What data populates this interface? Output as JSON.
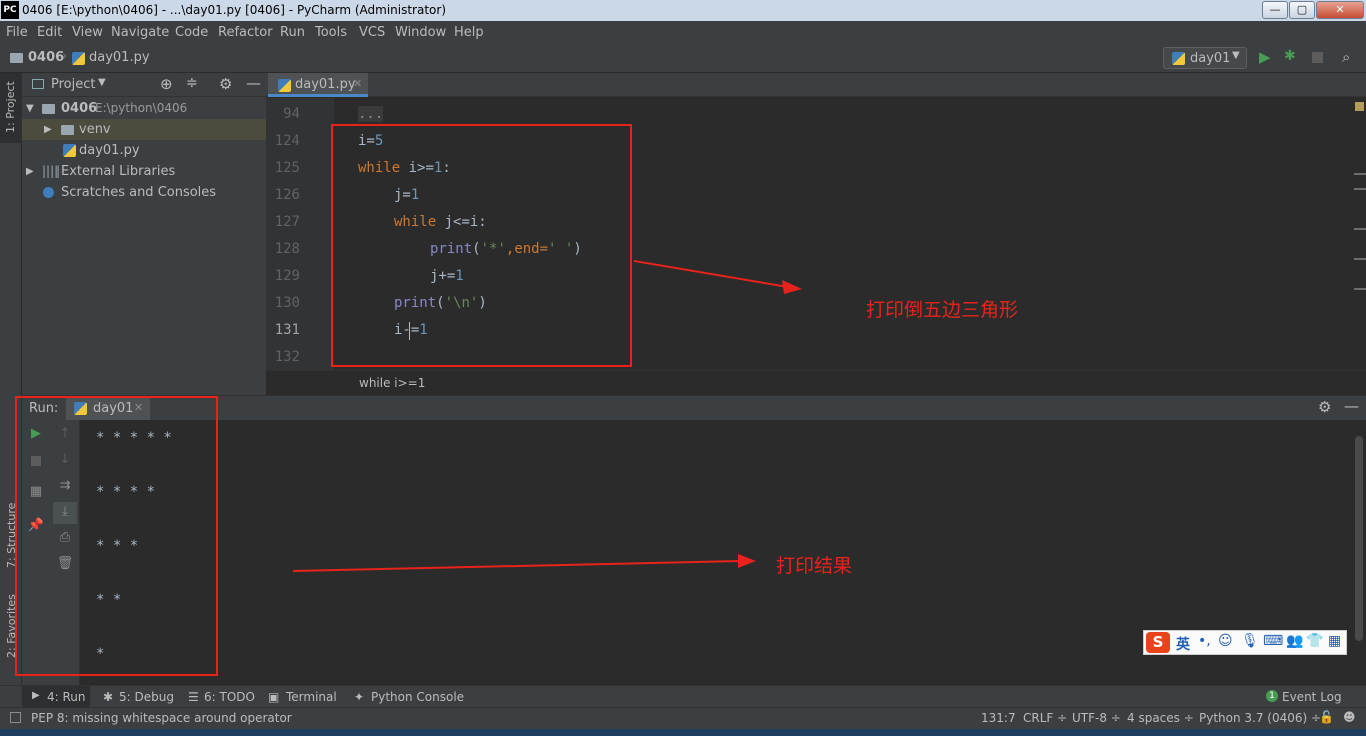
{
  "window": {
    "logo": "PC",
    "title": "0406 [E:\\python\\0406] - ...\\day01.py [0406] - PyCharm (Administrator)",
    "minimize": "—",
    "maximize": "▢",
    "close": "✕"
  },
  "menu": [
    "File",
    "Edit",
    "View",
    "Navigate",
    "Code",
    "Refactor",
    "Run",
    "Tools",
    "VCS",
    "Window",
    "Help"
  ],
  "nav": {
    "project": "0406",
    "file": "day01.py",
    "run_config": "day01"
  },
  "left_strip": {
    "project": "1: Project",
    "structure": "7: Structure",
    "favorites": "2: Favorites"
  },
  "project_panel": {
    "title": "Project",
    "tree": [
      {
        "name": "0406",
        "path": "E:\\python\\0406"
      },
      {
        "name": "venv"
      },
      {
        "name": "day01.py"
      },
      {
        "name": "External Libraries"
      },
      {
        "name": "Scratches and Consoles"
      }
    ]
  },
  "editor": {
    "tab": "day01.py",
    "line_numbers": [
      "94",
      "124",
      "125",
      "126",
      "127",
      "128",
      "129",
      "130",
      "131",
      "132"
    ],
    "folded": "...",
    "code": {
      "l124_a": "i=",
      "l124_b": "5",
      "l125_kw": "while",
      "l125_a": " i>=",
      "l125_b": "1",
      "l125_c": ":",
      "l126_a": "j=",
      "l126_b": "1",
      "l127_kw": "while",
      "l127_a": " j<=i:",
      "l128_fn": "print",
      "l128_a": "(",
      "l128_s": "'*'",
      "l128_c": ",",
      "l128_kw": "end=",
      "l128_s2": "' '",
      "l128_d": ")",
      "l129_a": "j+=",
      "l129_b": "1",
      "l130_fn": "print",
      "l130_a": "(",
      "l130_s": "'\\n'",
      "l130_d": ")",
      "l131_a": "i-=",
      "l131_b": "1"
    },
    "breadcrumb": "while i>=1"
  },
  "run": {
    "label": "Run:",
    "tab": "day01",
    "output": [
      "* * * * *",
      "* * * *",
      "* * *",
      "* *",
      "*"
    ]
  },
  "annotations": {
    "code": "打印倒五边三角形",
    "output": "打印结果"
  },
  "tool_windows": {
    "run": "4: Run",
    "debug": "5: Debug",
    "todo": "6: TODO",
    "terminal": "Terminal",
    "python_console": "Python Console",
    "event_log": "Event Log",
    "event_count": "1"
  },
  "status": {
    "message": "PEP 8: missing whitespace around operator",
    "position": "131:7",
    "line_sep": "CRLF ÷",
    "encoding": "UTF-8 ÷",
    "indent": "4 spaces ÷",
    "interpreter": "Python 3.7 (0406) ÷"
  },
  "ime": {
    "logo": "S",
    "lang": "英"
  }
}
